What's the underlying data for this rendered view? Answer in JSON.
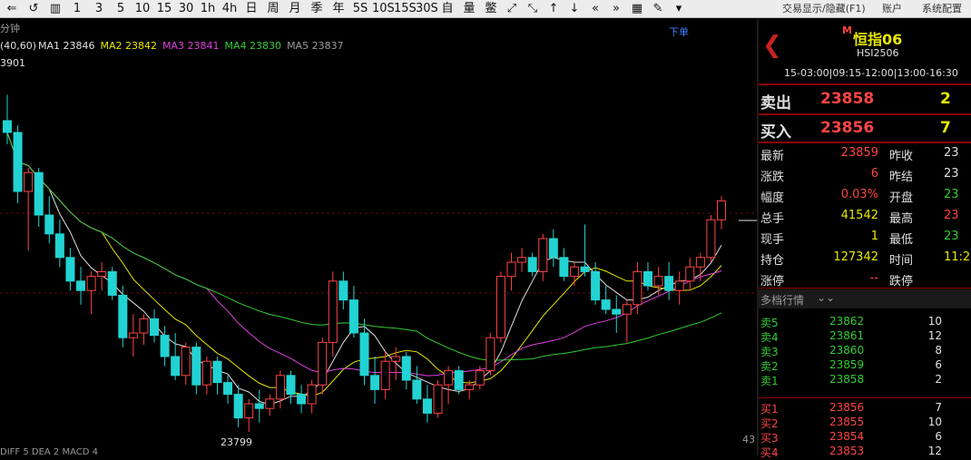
{
  "toolbar": {
    "icons": [
      "back-icon",
      "refresh-icon",
      "chart-icon",
      "fullscreen-icon",
      "collapse-icon",
      "up-icon",
      "down-icon",
      "rewind-icon",
      "forward-icon",
      "layout-icon",
      "pen-icon",
      "more-icon"
    ],
    "periods": [
      "1",
      "3",
      "5",
      "10",
      "15",
      "30",
      "1h",
      "4h",
      "日",
      "周",
      "月",
      "季",
      "年",
      "5S",
      "10S",
      "15S",
      "30S",
      "自",
      "量",
      "鳖"
    ],
    "right_items": [
      "交易显示/隐藏(F1)",
      "账户",
      "系统配置"
    ]
  },
  "chart": {
    "period_label": "分钟",
    "ma_params": "(40,60)",
    "ma": [
      {
        "name": "MA1",
        "value": "23846",
        "color": "#e0e0e0"
      },
      {
        "name": "MA2",
        "value": "23842",
        "color": "#e8e800"
      },
      {
        "name": "MA3",
        "value": "23841",
        "color": "#e040e0"
      },
      {
        "name": "MA4",
        "value": "23830",
        "color": "#33cc33"
      },
      {
        "name": "MA5",
        "value": "23837",
        "color": "#9a9a9a"
      }
    ],
    "high_label": "3901",
    "low_label": "23799",
    "order_label": "下单",
    "y_axis_value": "43",
    "indicator_label": "DIFF 5  DEA 2  MACD 4",
    "colors": {
      "up": "#ff4444",
      "down": "#22d3d3",
      "bg": "#000000"
    }
  },
  "chart_data": {
    "type": "candlestick",
    "ohlc": [
      [
        23890,
        23901,
        23880,
        23885
      ],
      [
        23885,
        23888,
        23855,
        23860
      ],
      [
        23860,
        23870,
        23835,
        23868
      ],
      [
        23868,
        23870,
        23845,
        23850
      ],
      [
        23850,
        23858,
        23838,
        23842
      ],
      [
        23842,
        23848,
        23828,
        23832
      ],
      [
        23832,
        23836,
        23818,
        23822
      ],
      [
        23822,
        23828,
        23812,
        23818
      ],
      [
        23818,
        23826,
        23808,
        23824
      ],
      [
        23824,
        23830,
        23818,
        23826
      ],
      [
        23826,
        23828,
        23814,
        23816
      ],
      [
        23816,
        23820,
        23794,
        23798
      ],
      [
        23798,
        23808,
        23790,
        23800
      ],
      [
        23800,
        23808,
        23795,
        23806
      ],
      [
        23806,
        23810,
        23796,
        23799
      ],
      [
        23799,
        23803,
        23786,
        23790
      ],
      [
        23790,
        23800,
        23780,
        23782
      ],
      [
        23782,
        23796,
        23778,
        23794
      ],
      [
        23794,
        23796,
        23774,
        23778
      ],
      [
        23778,
        23790,
        23774,
        23788
      ],
      [
        23788,
        23790,
        23774,
        23779
      ],
      [
        23779,
        23782,
        23770,
        23774
      ],
      [
        23774,
        23778,
        23760,
        23764
      ],
      [
        23764,
        23772,
        23758,
        23770
      ],
      [
        23770,
        23776,
        23762,
        23768
      ],
      [
        23768,
        23774,
        23765,
        23772
      ],
      [
        23772,
        23784,
        23768,
        23782
      ],
      [
        23782,
        23784,
        23770,
        23774
      ],
      [
        23774,
        23778,
        23766,
        23770
      ],
      [
        23770,
        23780,
        23766,
        23778
      ],
      [
        23778,
        23798,
        23774,
        23796
      ],
      [
        23796,
        23826,
        23790,
        23822
      ],
      [
        23822,
        23826,
        23810,
        23814
      ],
      [
        23814,
        23820,
        23798,
        23800
      ],
      [
        23800,
        23806,
        23778,
        23782
      ],
      [
        23782,
        23790,
        23770,
        23776
      ],
      [
        23776,
        23792,
        23772,
        23788
      ],
      [
        23788,
        23794,
        23780,
        23790
      ],
      [
        23790,
        23792,
        23776,
        23780
      ],
      [
        23780,
        23786,
        23770,
        23772
      ],
      [
        23772,
        23778,
        23762,
        23766
      ],
      [
        23766,
        23780,
        23764,
        23778
      ],
      [
        23778,
        23786,
        23770,
        23784
      ],
      [
        23784,
        23786,
        23774,
        23776
      ],
      [
        23776,
        23780,
        23772,
        23778
      ],
      [
        23778,
        23786,
        23776,
        23784
      ],
      [
        23784,
        23800,
        23782,
        23798
      ],
      [
        23798,
        23826,
        23796,
        23824
      ],
      [
        23824,
        23834,
        23818,
        23830
      ],
      [
        23830,
        23836,
        23826,
        23832
      ],
      [
        23832,
        23834,
        23824,
        23826
      ],
      [
        23826,
        23842,
        23822,
        23840
      ],
      [
        23840,
        23844,
        23828,
        23832
      ],
      [
        23832,
        23836,
        23822,
        23824
      ],
      [
        23824,
        23830,
        23820,
        23828
      ],
      [
        23828,
        23846,
        23824,
        23826
      ],
      [
        23826,
        23830,
        23812,
        23814
      ],
      [
        23814,
        23820,
        23808,
        23810
      ],
      [
        23810,
        23816,
        23800,
        23808
      ],
      [
        23808,
        23814,
        23796,
        23812
      ],
      [
        23812,
        23830,
        23808,
        23826
      ],
      [
        23826,
        23830,
        23818,
        23820
      ],
      [
        23820,
        23828,
        23816,
        23824
      ],
      [
        23824,
        23830,
        23814,
        23818
      ],
      [
        23818,
        23826,
        23812,
        23822
      ],
      [
        23822,
        23832,
        23818,
        23828
      ],
      [
        23828,
        23834,
        23822,
        23832
      ],
      [
        23832,
        23850,
        23830,
        23848
      ],
      [
        23848,
        23858,
        23844,
        23856
      ]
    ],
    "ma_lines": [
      {
        "name": "MA1",
        "color": "#e0e0e0"
      },
      {
        "name": "MA2",
        "color": "#e8e800"
      },
      {
        "name": "MA3",
        "color": "#e040e0"
      },
      {
        "name": "MA4",
        "color": "#33cc33"
      }
    ],
    "ylim": [
      23760,
      23910
    ]
  },
  "panel": {
    "flag": "M",
    "name": "恒指06",
    "code": "HSI2506",
    "sessions": "15-03:00|09:15-12:00|13:00-16:30",
    "sell_label": "卖出",
    "sell_price": "23858",
    "sell_qty": "2",
    "buy_label": "买入",
    "buy_price": "23856",
    "buy_qty": "7",
    "stats": [
      {
        "l1": "最新",
        "v1": "23859",
        "c1": "red",
        "l2": "昨收",
        "v2": "23",
        "c2": "wht"
      },
      {
        "l1": "涨跌",
        "v1": "6",
        "c1": "red",
        "l2": "昨结",
        "v2": "23",
        "c2": "wht"
      },
      {
        "l1": "幅度",
        "v1": "0.03%",
        "c1": "red",
        "l2": "开盘",
        "v2": "23",
        "c2": "grn"
      },
      {
        "l1": "总手",
        "v1": "41542",
        "c1": "yel",
        "l2": "最高",
        "v2": "23",
        "c2": "red"
      },
      {
        "l1": "现手",
        "v1": "1",
        "c1": "yel",
        "l2": "最低",
        "v2": "23",
        "c2": "grn"
      },
      {
        "l1": "持仓",
        "v1": "127342",
        "c1": "yel",
        "l2": "时间",
        "v2": "11:25",
        "c2": "yel"
      },
      {
        "l1": "涨停",
        "v1": "--",
        "c1": "red",
        "l2": "跌停",
        "v2": "",
        "c2": "grn"
      }
    ],
    "depth_title": "多档行情",
    "asks": [
      {
        "label": "卖5",
        "price": "23862",
        "qty": "10"
      },
      {
        "label": "卖4",
        "price": "23861",
        "qty": "12"
      },
      {
        "label": "卖3",
        "price": "23860",
        "qty": "8"
      },
      {
        "label": "卖2",
        "price": "23859",
        "qty": "6"
      },
      {
        "label": "卖1",
        "price": "23858",
        "qty": "2"
      }
    ],
    "bids": [
      {
        "label": "买1",
        "price": "23856",
        "qty": "7"
      },
      {
        "label": "买2",
        "price": "23855",
        "qty": "10"
      },
      {
        "label": "买3",
        "price": "23854",
        "qty": "6"
      },
      {
        "label": "买4",
        "price": "23853",
        "qty": "12"
      }
    ]
  }
}
